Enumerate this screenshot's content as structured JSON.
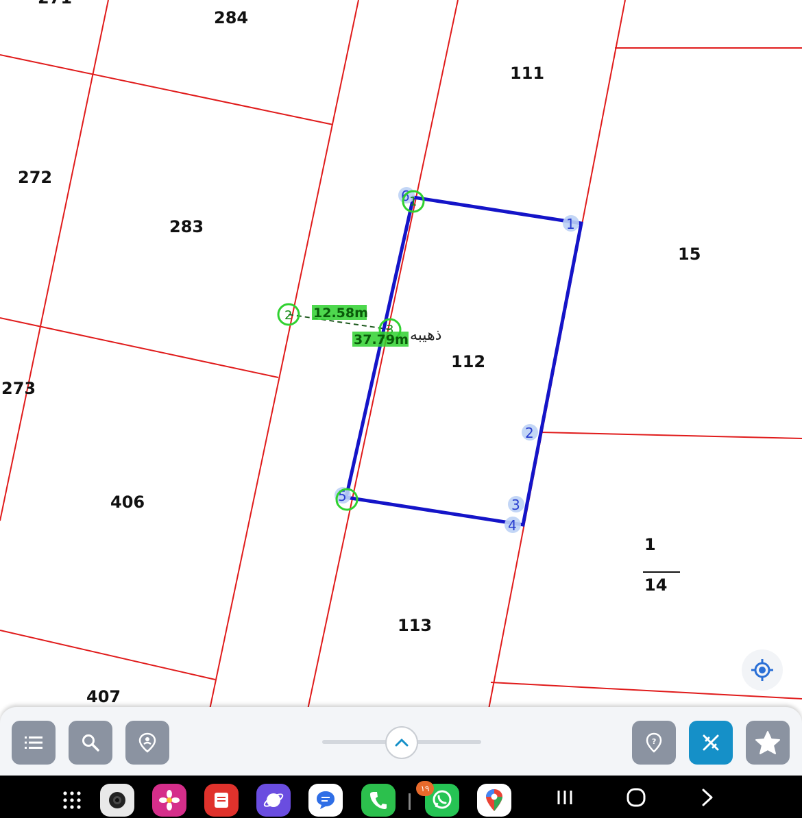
{
  "map": {
    "parcels": [
      {
        "id": "p271",
        "label": "271"
      },
      {
        "id": "p284",
        "label": "284"
      },
      {
        "id": "p111",
        "label": "111"
      },
      {
        "id": "p272",
        "label": "272"
      },
      {
        "id": "p283",
        "label": "283"
      },
      {
        "id": "p15",
        "label": "15"
      },
      {
        "id": "p112",
        "label": "112"
      },
      {
        "id": "p273",
        "label": "273"
      },
      {
        "id": "p406",
        "label": "406"
      },
      {
        "id": "p113",
        "label": "113"
      },
      {
        "id": "p407",
        "label": "407"
      }
    ],
    "fraction_parcel": {
      "numerator": "1",
      "denominator": "14"
    },
    "street_name": "ذهيبه",
    "measurements": {
      "segment_1": "12.58m",
      "segment_2": "37.79m"
    },
    "polygon_vertices": [
      "1",
      "2",
      "3",
      "4",
      "5",
      "6"
    ],
    "measure_points": [
      "1",
      "2",
      "3"
    ],
    "colors": {
      "parcel_lines": "#e01b1b",
      "selection_polygon": "#1414c8",
      "measurement": "#2fd12f",
      "accent": "#1590c8"
    }
  },
  "locate_button": {
    "icon": "crosshair-icon"
  },
  "toolbar": {
    "left_buttons": [
      {
        "name": "list-button",
        "icon": "list-icon"
      },
      {
        "name": "search-button",
        "icon": "search-icon"
      },
      {
        "name": "place-button",
        "icon": "place-pin-icon"
      }
    ],
    "right_buttons": [
      {
        "name": "marker-button",
        "icon": "marker-icon"
      },
      {
        "name": "measure-tool-button",
        "icon": "ruler-pencil-icon",
        "active": true
      },
      {
        "name": "favorites-button",
        "icon": "star-icon"
      }
    ],
    "expand_handle": {
      "icon": "chevron-up-icon"
    }
  },
  "taskbar": {
    "apps": [
      "app-grid",
      "camera",
      "gallery",
      "notes",
      "browser",
      "messages",
      "phone",
      "whatsapp",
      "maps"
    ],
    "whatsapp_badge": "۱۹",
    "nav": [
      "recents-icon",
      "home-icon",
      "back-icon"
    ]
  }
}
